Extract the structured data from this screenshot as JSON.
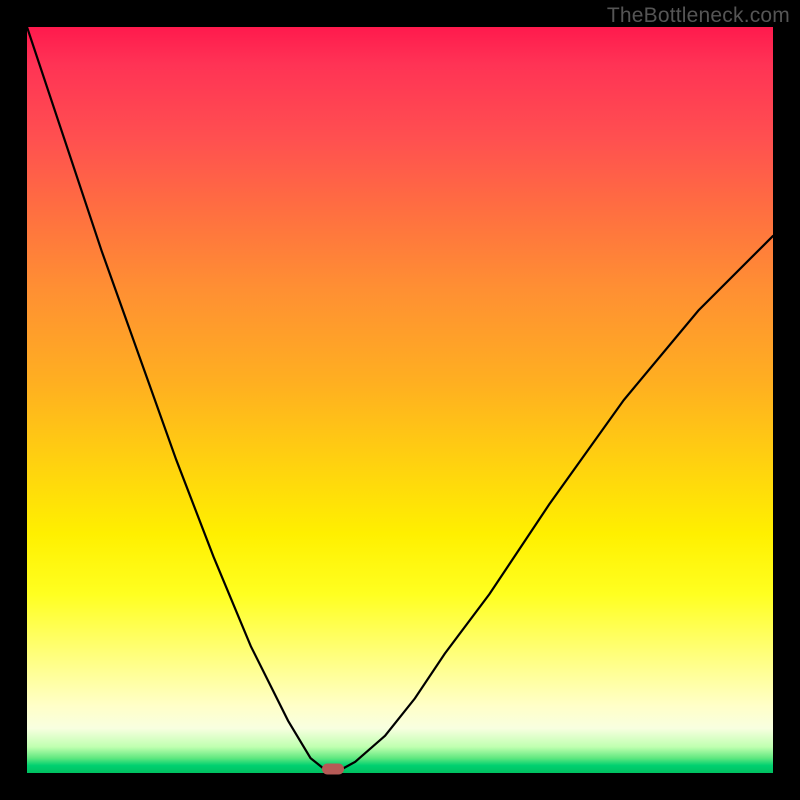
{
  "watermark": "TheBottleneck.com",
  "chart_data": {
    "type": "line",
    "title": "",
    "xlabel": "",
    "ylabel": "",
    "xlim": [
      0,
      100
    ],
    "ylim": [
      0,
      100
    ],
    "series": [
      {
        "name": "bottleneck-curve",
        "x": [
          0,
          5,
          10,
          15,
          20,
          25,
          30,
          35,
          38,
          40,
          41,
          42,
          44,
          48,
          52,
          56,
          62,
          70,
          80,
          90,
          100
        ],
        "values": [
          100,
          85,
          70,
          56,
          42,
          29,
          17,
          7,
          2,
          0.4,
          0,
          0.4,
          1.5,
          5,
          10,
          16,
          24,
          36,
          50,
          62,
          72
        ]
      }
    ],
    "marker": {
      "x": 41,
      "y": 0.5,
      "name": "optimal-point"
    },
    "gradient_stops": [
      {
        "pct": 0,
        "color": "#ff1a4d"
      },
      {
        "pct": 50,
        "color": "#ffd010"
      },
      {
        "pct": 95,
        "color": "#ffffc8"
      },
      {
        "pct": 100,
        "color": "#00c060"
      }
    ]
  }
}
